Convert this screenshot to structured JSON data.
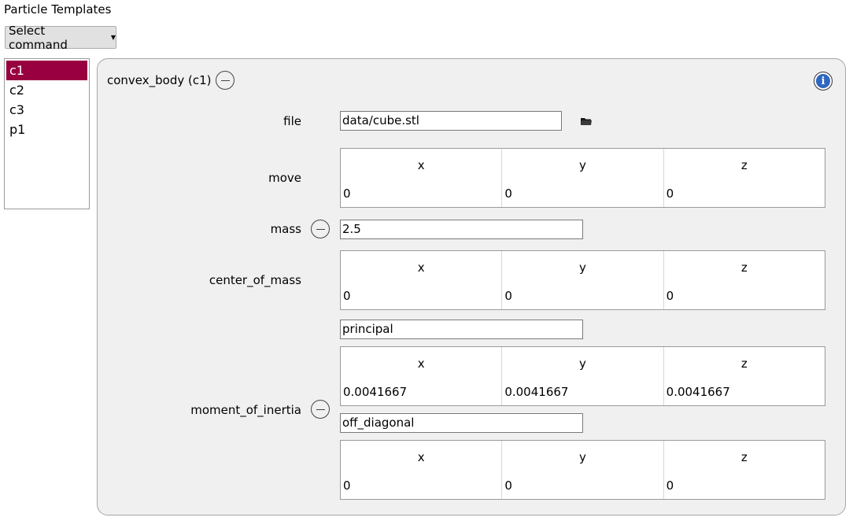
{
  "header": {
    "title": "Particle Templates"
  },
  "command": {
    "label": "Select command"
  },
  "templates": [
    {
      "label": "c1",
      "selected": true
    },
    {
      "label": "c2"
    },
    {
      "label": "c3"
    },
    {
      "label": "p1"
    }
  ],
  "panel": {
    "title": "convex_body (c1)",
    "file": {
      "label": "file",
      "value": "data/cube.stl"
    },
    "move": {
      "label": "move",
      "headers": [
        "x",
        "y",
        "z"
      ],
      "values": [
        "0",
        "0",
        "0"
      ]
    },
    "mass": {
      "label": "mass",
      "value": "2.5"
    },
    "center_of_mass": {
      "label": "center_of_mass",
      "headers": [
        "x",
        "y",
        "z"
      ],
      "values": [
        "0",
        "0",
        "0"
      ]
    },
    "moment_of_inertia": {
      "label": "moment_of_inertia",
      "principal_label": "principal",
      "principal": {
        "headers": [
          "x",
          "y",
          "z"
        ],
        "values": [
          "0.0041667",
          "0.0041667",
          "0.0041667"
        ]
      },
      "off_diagonal_label": "off_diagonal",
      "off_diagonal": {
        "headers": [
          "x",
          "y",
          "z"
        ],
        "values": [
          "0",
          "0",
          "0"
        ]
      }
    }
  },
  "colors": {
    "selection": "#990040",
    "panel_bg": "#f0f0f0",
    "info_blue": "#2f67c0"
  },
  "icons": {
    "info": "info-icon",
    "folder": "folder-icon",
    "remove": "minus-circle-icon",
    "dropdown": "dropdown-arrow-icon"
  }
}
